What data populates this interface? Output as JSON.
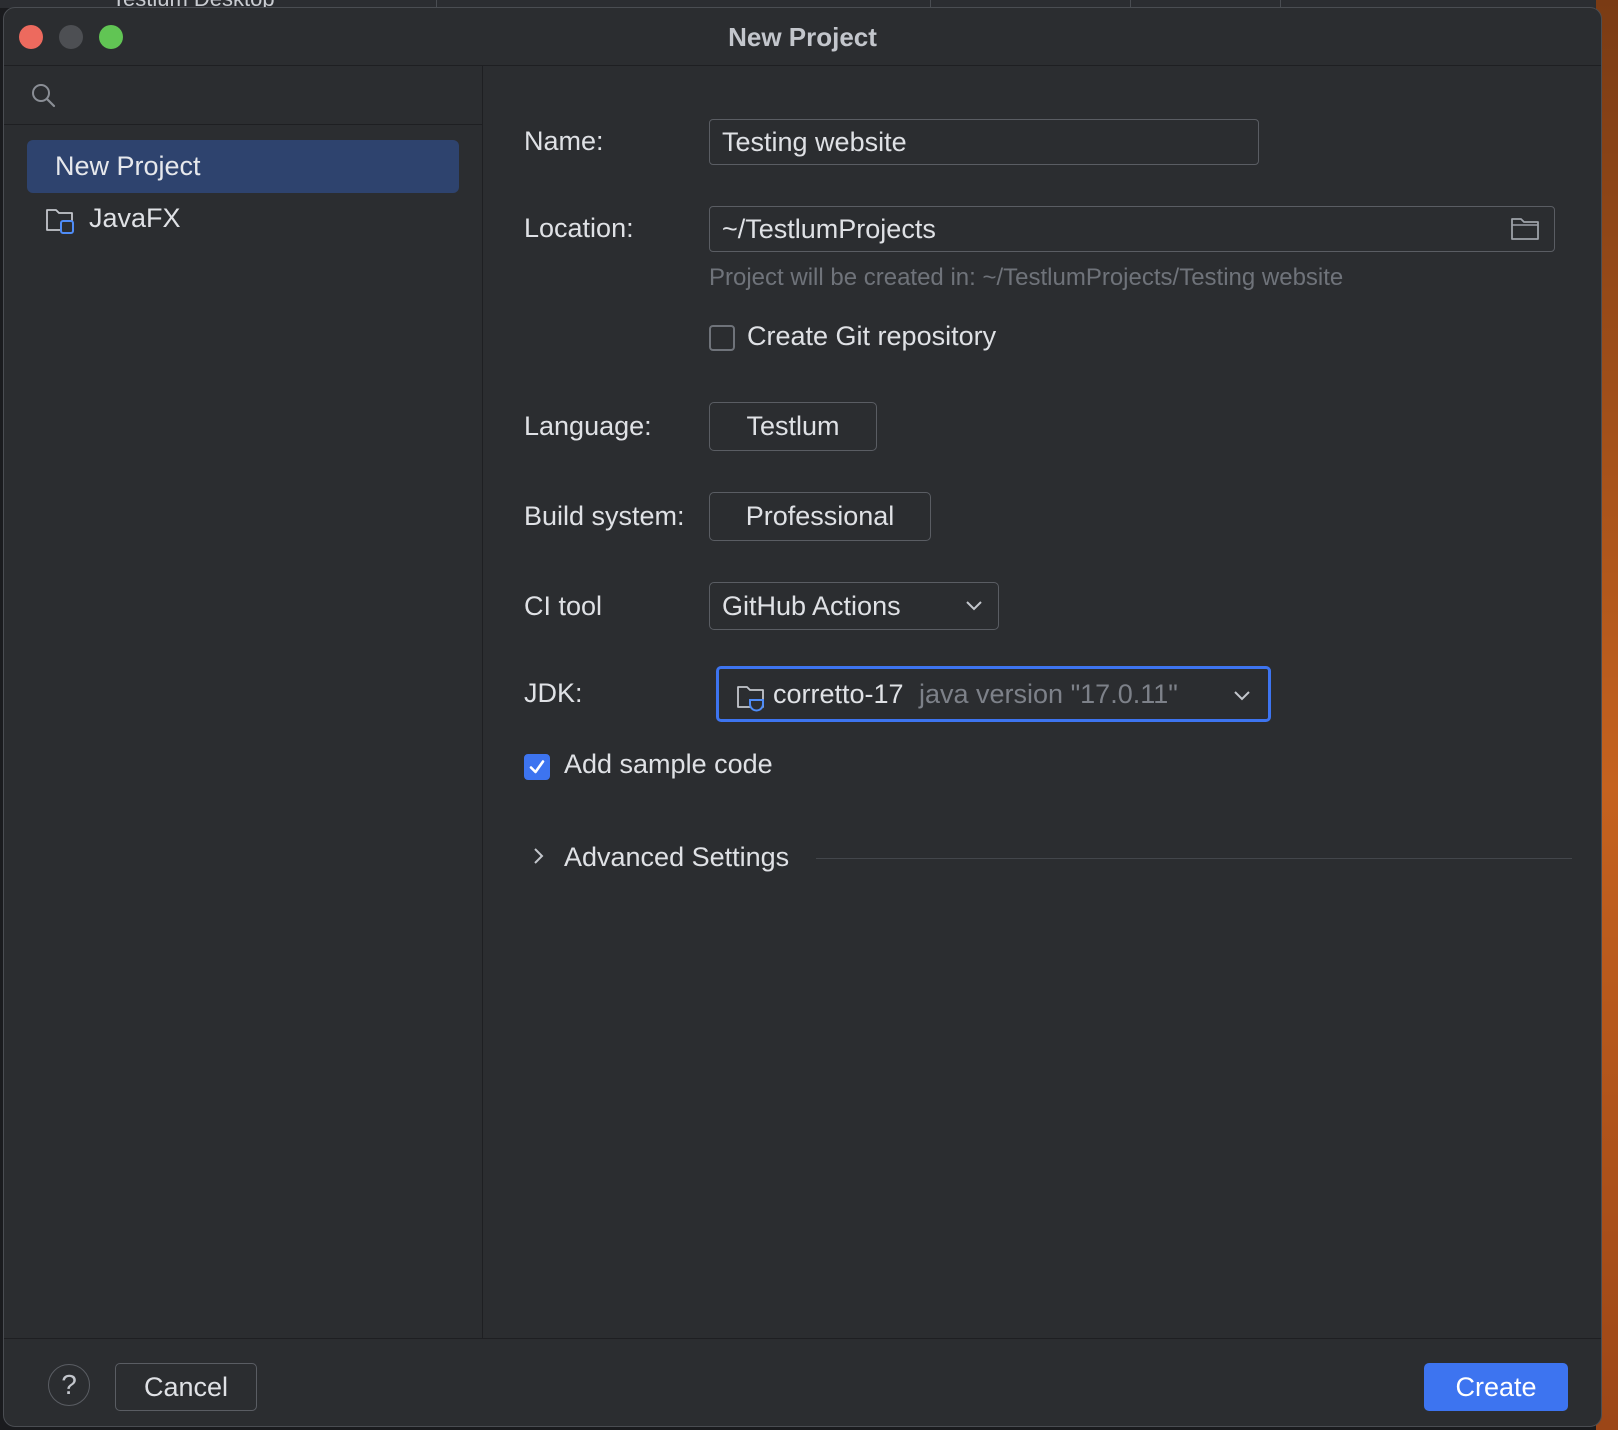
{
  "background_app": {
    "title": "Testlum Desktop"
  },
  "colors": {
    "accent": "#3d74f0",
    "selection": "#2e436e",
    "window_bg": "#2b2d30",
    "close": "#ed6a5e",
    "maximize": "#61c554"
  },
  "window": {
    "title": "New Project"
  },
  "sidebar": {
    "search": {
      "icon": "search-icon",
      "placeholder": ""
    },
    "items": [
      {
        "label": "New Project",
        "selected": true
      },
      {
        "label": "JavaFX",
        "icon": "javafx-folder-icon",
        "selected": false
      }
    ]
  },
  "form": {
    "name": {
      "label": "Name:",
      "value": "Testing website"
    },
    "location": {
      "label": "Location:",
      "value": "~/TestlumProjects",
      "browse_icon": "folder-icon"
    },
    "location_hint": "Project will be created in: ~/TestlumProjects/Testing website",
    "git": {
      "label": "Create Git repository",
      "checked": false
    },
    "language": {
      "label": "Language:",
      "option": "Testlum"
    },
    "build_system": {
      "label": "Build system:",
      "option": "Professional"
    },
    "ci_tool": {
      "label": "CI tool",
      "value": "GitHub Actions"
    },
    "jdk": {
      "label": "JDK:",
      "name": "corretto-17",
      "version": "java version \"17.0.11\"",
      "icon": "jdk-folder-icon"
    },
    "sample_code": {
      "label": "Add sample code",
      "checked": true
    },
    "advanced": {
      "label": "Advanced Settings",
      "expanded": false
    }
  },
  "footer": {
    "help": "?",
    "cancel": "Cancel",
    "create": "Create"
  }
}
